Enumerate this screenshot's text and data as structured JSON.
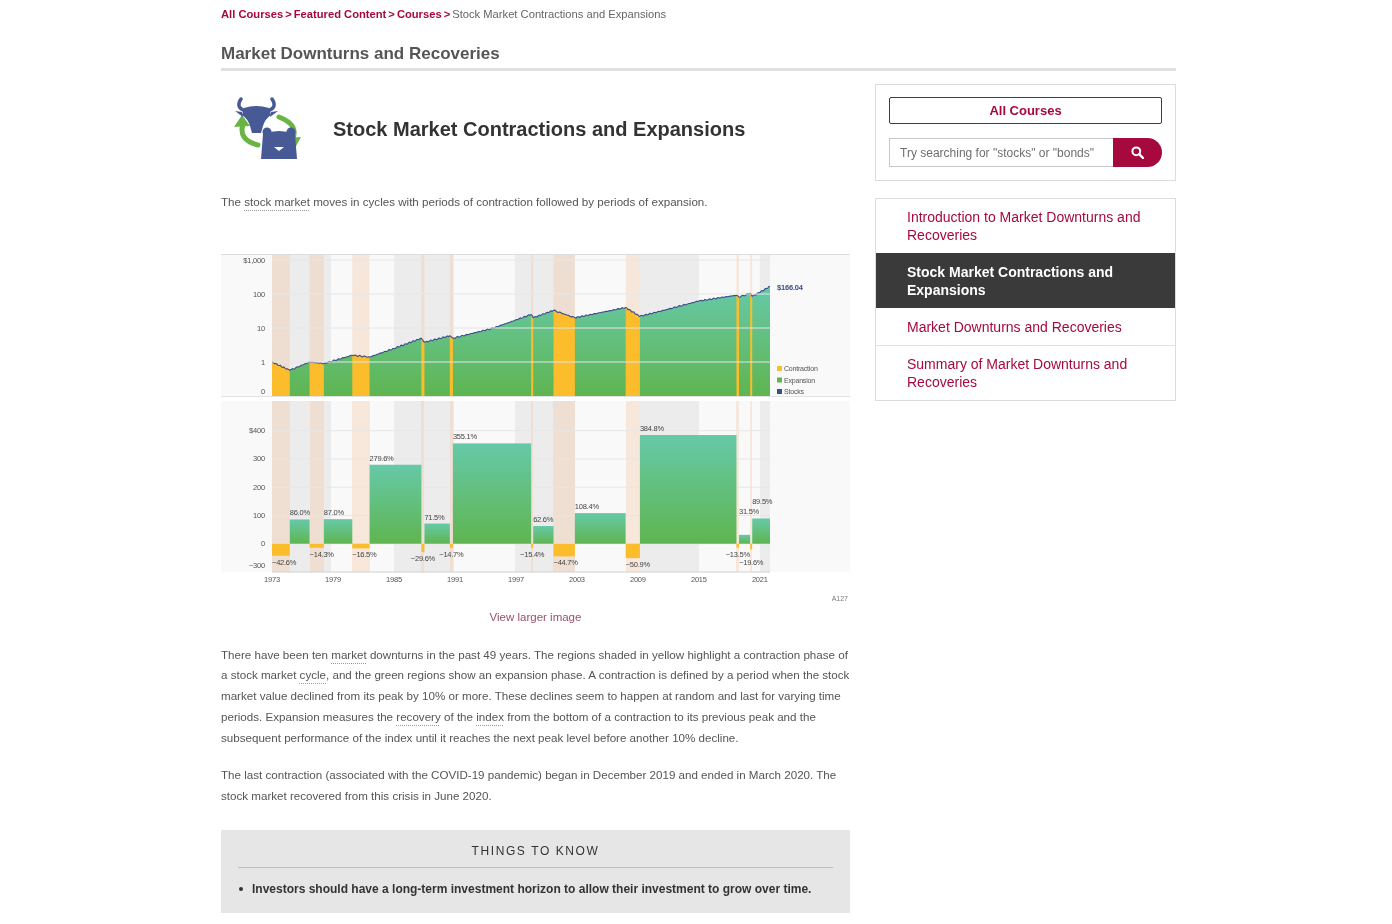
{
  "breadcrumb": {
    "links": [
      {
        "label": "All Courses",
        "separator": ">"
      },
      {
        "label": "Featured Content",
        "separator": ">"
      },
      {
        "label": "Courses",
        "separator": ">"
      }
    ],
    "current": "Stock Market Contractions and Expansions"
  },
  "page_title": "Market Downturns and Recoveries",
  "lesson": {
    "title": "Stock Market Contractions and Expansions",
    "intro": [
      {
        "kind": "text",
        "text": "The "
      },
      {
        "kind": "term",
        "text": "stock market"
      },
      {
        "kind": "text",
        "text": " moves in cycles with periods of contraction followed by periods of expansion."
      }
    ]
  },
  "figure": {
    "growth_panel": {
      "y_labels": [
        "$1,000",
        "100",
        "10",
        "1",
        "0"
      ],
      "end_value": "$166.04"
    },
    "legend": [
      {
        "label": "Contraction",
        "color": "#fbbd2c"
      },
      {
        "label": "Expansion",
        "color": "#5fb550"
      },
      {
        "label": "Stocks",
        "color": "#3c4d8c"
      }
    ],
    "chart_data": {
      "type": "bar",
      "x": [
        1973.875,
        1975.725,
        1977.4,
        1979.5,
        1981.75,
        1985.15,
        1987.85,
        1989.25,
        1990.65,
        1994.65,
        1998.6,
        1999.7,
        2001.75,
        2005.3,
        2008.5,
        2013.95,
        2018.825,
        2019.5,
        2020.15,
        2021.125
      ],
      "xlim": [
        1973,
        2022
      ],
      "ylim": [
        -100,
        400
      ],
      "xticks": [
        1973,
        1979,
        1985,
        1991,
        1997,
        2003,
        2009,
        2015,
        2021
      ],
      "yticks": [
        {
          "value": 400,
          "label": "$400"
        },
        300,
        200,
        100,
        0
      ],
      "grid": true,
      "values": [
        -42.6,
        86.0,
        -14.3,
        87.0,
        -16.5,
        279.6,
        -29.6,
        71.5,
        -14.7,
        355.1,
        -15.4,
        62.6,
        -44.7,
        108.4,
        -50.9,
        384.8,
        -13.5,
        31.5,
        -19.6,
        89.5
      ],
      "value_labels": [
        "−42.6%",
        "86.0%",
        "−14.3%",
        "87.0%",
        "−16.5%",
        "279.6%",
        "−29.6%",
        "71.5%",
        "−14.7%",
        "355.1%",
        "−15.4%",
        "62.6%",
        "−44.7%",
        "108.4%",
        "−50.9%",
        "384.8%",
        "−13.5%",
        "31.5%",
        "−19.6%",
        "89.5%"
      ]
    },
    "axis_floor_label": "−300",
    "code": "A127",
    "link": "View larger image"
  },
  "paragraphs": [
    [
      {
        "kind": "text",
        "text": "There have been ten "
      },
      {
        "kind": "term",
        "text": "market"
      },
      {
        "kind": "text",
        "text": " downturns in the past 49 years. The regions shaded in yellow highlight a contraction phase of a stock market "
      },
      {
        "kind": "term",
        "text": "cycle"
      },
      {
        "kind": "text",
        "text": ", and the green regions show an expansion phase. A contraction is defined by a period when the stock market value declined from its peak by 10% or more. These declines seem to happen at random and last for varying time periods. Expansion measures the "
      },
      {
        "kind": "term",
        "text": "recovery"
      },
      {
        "kind": "text",
        "text": " of the "
      },
      {
        "kind": "term",
        "text": "index"
      },
      {
        "kind": "text",
        "text": " from the bottom of a contraction to its previous peak and the subsequent performance of the index until it reaches the next peak level before another 10% decline."
      }
    ],
    [
      {
        "kind": "text",
        "text": "The last contraction (associated with the COVID-19 pandemic) began in December 2019 and ended in March 2020. The stock market recovered from this crisis in June 2020."
      }
    ]
  ],
  "things_to_know": {
    "heading": "THINGS TO KNOW",
    "items": [
      "Investors should have a long-term investment horizon to allow their investment to grow over time."
    ]
  },
  "sidebar": {
    "all_courses": "All Courses",
    "search": {
      "placeholder": "Try searching for \"stocks\" or \"bonds\""
    },
    "nav": [
      {
        "label": "Introduction to Market Downturns and Recoveries",
        "selected": false
      },
      {
        "label": "Stock Market Contractions and Expansions",
        "selected": true
      },
      {
        "label": "Market Downturns and Recoveries",
        "selected": false
      },
      {
        "label": "Summary of Market Downturns and Recoveries",
        "selected": false
      }
    ]
  }
}
